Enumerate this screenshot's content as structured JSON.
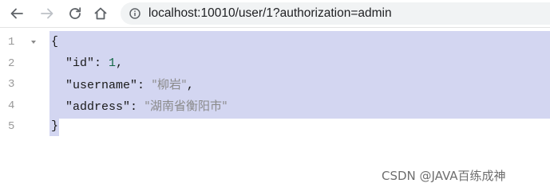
{
  "browser": {
    "url": "localhost:10010/user/1?authorization=admin",
    "icons": {
      "back": "arrow-left-icon",
      "forward": "arrow-right-icon",
      "reload": "reload-icon",
      "home": "home-icon",
      "site_info": "info-circle-icon"
    }
  },
  "viewer": {
    "line_numbers": [
      "1",
      "2",
      "3",
      "4",
      "5"
    ],
    "lines": {
      "l1": {
        "open": "{"
      },
      "l2": {
        "key": "\"id\"",
        "sep": ": ",
        "value": "1",
        "end": ","
      },
      "l3": {
        "key": "\"username\"",
        "sep": ": ",
        "value": "\"柳岩\"",
        "end": ","
      },
      "l4": {
        "key": "\"address\"",
        "sep": ": ",
        "value": "\"湖南省衡阳市\""
      },
      "l5": {
        "close": "}"
      }
    },
    "selection_color": "#d3d6f1"
  },
  "watermark": "CSDN @JAVA百练成神"
}
